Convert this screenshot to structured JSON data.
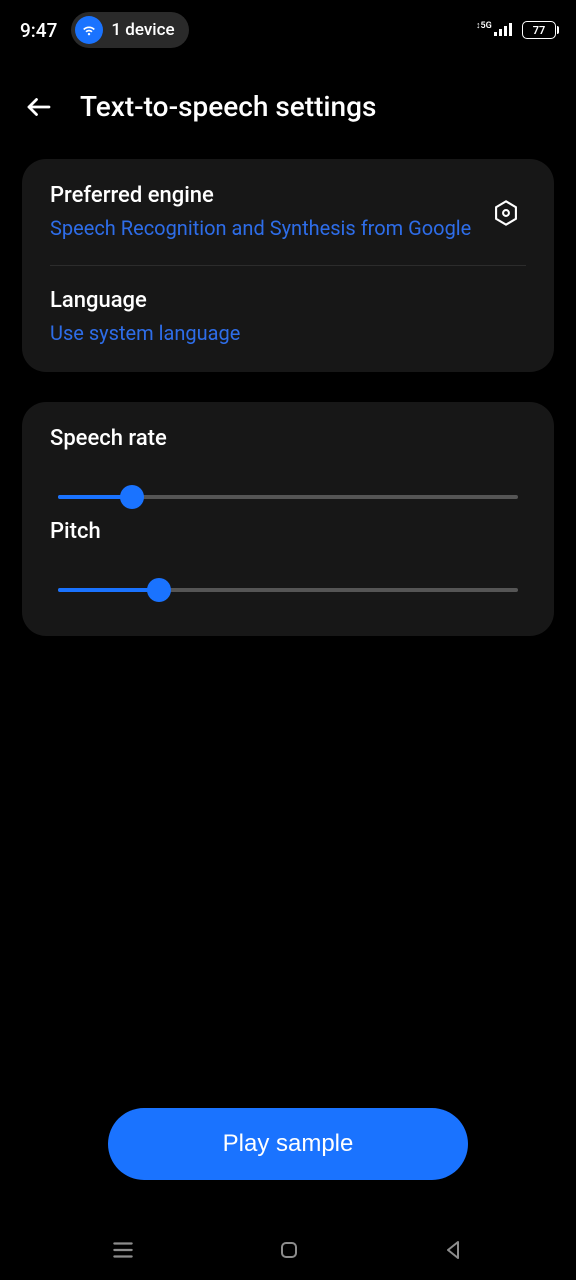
{
  "status_bar": {
    "time": "9:47",
    "device_chip": "1 device",
    "network": "5G",
    "battery": "77"
  },
  "header": {
    "title": "Text-to-speech settings"
  },
  "engine_card": {
    "title": "Preferred engine",
    "subtitle": "Speech Recognition and Synthesis from Google",
    "lang_title": "Language",
    "lang_subtitle": "Use system language"
  },
  "sliders": {
    "rate_label": "Speech rate",
    "rate_percent": 16,
    "pitch_label": "Pitch",
    "pitch_percent": 22
  },
  "actions": {
    "play": "Play sample"
  }
}
